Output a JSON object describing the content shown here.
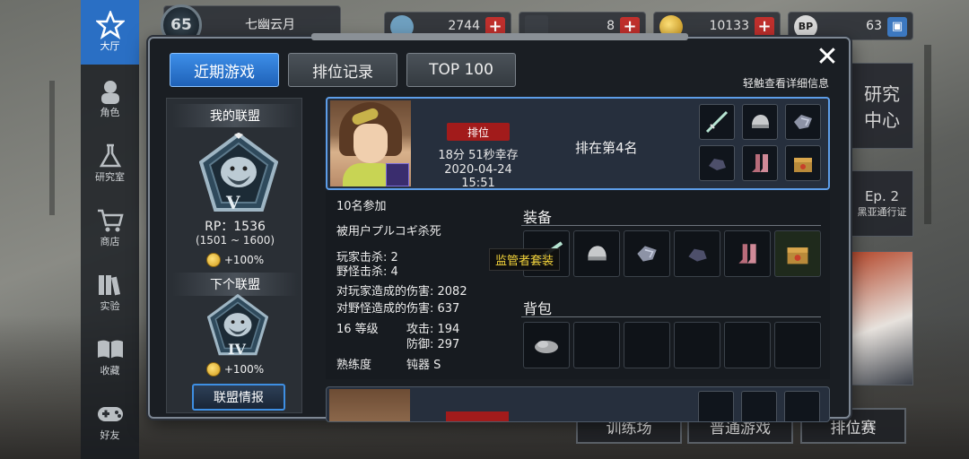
{
  "player": {
    "level": "65",
    "name": "七幽云月"
  },
  "resources": [
    {
      "value": "2744",
      "action": "+"
    },
    {
      "value": "8",
      "action": "+"
    },
    {
      "value": "10133",
      "action": "+"
    },
    {
      "value": "63",
      "action": ""
    }
  ],
  "nav": [
    {
      "label": "大厅"
    },
    {
      "label": "角色"
    },
    {
      "label": "研究室"
    },
    {
      "label": "商店"
    },
    {
      "label": "实验"
    },
    {
      "label": "收藏"
    },
    {
      "label": "好友"
    }
  ],
  "modal": {
    "close_label": "✕",
    "tabs": [
      "近期游戏",
      "排位记录",
      "TOP 100"
    ],
    "hint": "轻触查看详细信息"
  },
  "league": {
    "my_title": "我的联盟",
    "my_tier": "V",
    "rp": "RP：1536",
    "rp_range": "(1501 ~ 1600)",
    "my_bonus": "+100%",
    "next_title": "下个联盟",
    "next_tier": "IV",
    "next_bonus": "+100%",
    "info_button": "联盟情报"
  },
  "match": {
    "mode_tag": "排位",
    "survive_time": "18分 51秒幸存",
    "date": "2020-04-24 15:51",
    "placement": "排在第4名",
    "participants": "10名参加",
    "killed_by": "被用户プルコギ杀死",
    "player_kills": "玩家击杀: 2",
    "monster_kills": "野怪击杀: 4",
    "player_damage": "对玩家造成的伤害: 2082",
    "monster_damage": "对野怪造成的伤害: 637",
    "level": "16 等级",
    "attack": "攻击: 194",
    "defense": "防御: 297",
    "proficiency_label": "熟练度",
    "proficiency_value": "钝器 S",
    "equipment_title": "装备",
    "backpack_title": "背包",
    "tooltip": "监管者套装"
  },
  "bottom_buttons": [
    "训练场",
    "普通游戏",
    "排位赛"
  ],
  "side": {
    "research_title": "研究中心",
    "pass_title": "Ep. 2",
    "pass_sub": "黑亚通行证"
  }
}
